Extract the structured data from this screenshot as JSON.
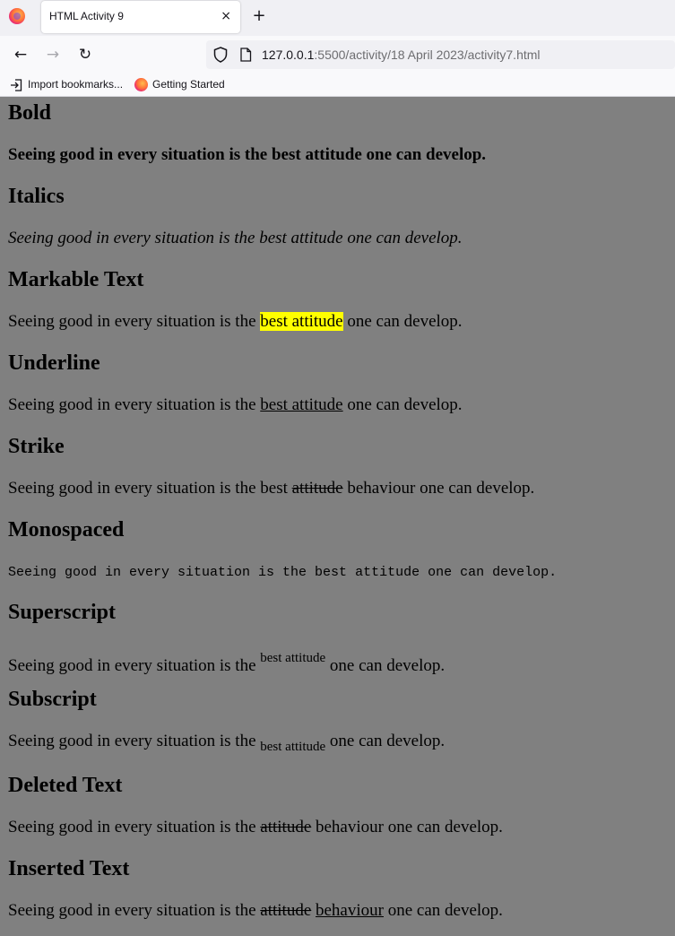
{
  "browser": {
    "tab_title": "HTML Activity 9",
    "tab_close": "×",
    "new_tab": "+",
    "back": "←",
    "forward": "→",
    "reload": "↻",
    "url_host": "127.0.0.1",
    "url_rest": ":5500/activity/18 April 2023/activity7.html",
    "bookmarks": [
      {
        "label": "Import bookmarks..."
      },
      {
        "label": "Getting Started"
      }
    ]
  },
  "page": {
    "bold": {
      "heading": "Bold",
      "text": "Seeing good in every situation is the best attitude one can develop."
    },
    "italics": {
      "heading": "Italics",
      "text": "Seeing good in every situation is the best attitude one can develop."
    },
    "mark": {
      "heading": "Markable Text",
      "before": "Seeing good in every situation is the ",
      "marked": "best attitude",
      "after": " one can develop.",
      "highlight_color": "#ffff00"
    },
    "underline": {
      "heading": "Underline",
      "before": "Seeing good in every situation is the ",
      "underlined": "best attitude",
      "after": " one can develop."
    },
    "strike": {
      "heading": "Strike",
      "before": "Seeing good in every situation is the best ",
      "struck": "attitude",
      "after": " behaviour one can develop."
    },
    "mono": {
      "heading": "Monospaced",
      "text": "Seeing good in every situation is the best attitude one can develop."
    },
    "superscript": {
      "heading": "Superscript",
      "before": "Seeing good in every situation is the ",
      "sup": "best attitude",
      "after": " one can develop."
    },
    "subscript": {
      "heading": "Subscript",
      "before": "Seeing good in every situation is the ",
      "sub": "best attitude",
      "after": " one can develop."
    },
    "deleted": {
      "heading": "Deleted Text",
      "before": "Seeing good in every situation is the ",
      "del": "attitude",
      "after": " behaviour one can develop."
    },
    "inserted": {
      "heading": "Inserted Text",
      "before": "Seeing good in every situation is the ",
      "del": "attitude",
      "space": " ",
      "ins": "behaviour",
      "after": " one can develop."
    }
  },
  "colors": {
    "page_background": "#808080",
    "highlight": "#ffff00"
  }
}
